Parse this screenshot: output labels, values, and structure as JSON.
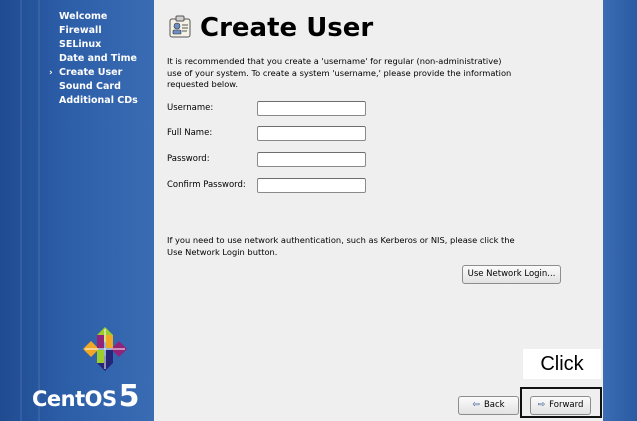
{
  "sidebar": {
    "steps": [
      {
        "label": "Welcome",
        "current": false
      },
      {
        "label": "Firewall",
        "current": false
      },
      {
        "label": "SELinux",
        "current": false
      },
      {
        "label": "Date and Time",
        "current": false
      },
      {
        "label": "Create User",
        "current": true
      },
      {
        "label": "Sound Card",
        "current": false
      },
      {
        "label": "Additional CDs",
        "current": false
      }
    ],
    "current_marker": "›",
    "logo": {
      "text": "CentOS",
      "number": "5"
    }
  },
  "page": {
    "title": "Create User",
    "intro": "It is recommended that you create a 'username' for regular (non-administrative) use of your system. To create a system 'username,' please provide the information requested below.",
    "network_text": "If you need to use network authentication, such as Kerberos or NIS, please click the Use Network Login button."
  },
  "form": {
    "username": {
      "label": "Username:",
      "value": ""
    },
    "full_name": {
      "label": "Full Name:",
      "value": ""
    },
    "password": {
      "label": "Password:",
      "value": ""
    },
    "confirm_password": {
      "label": "Confirm Password:",
      "value": ""
    }
  },
  "buttons": {
    "network_login": "Use Network Login...",
    "back": "Back",
    "forward": "Forward"
  },
  "annotation": {
    "label": "Click"
  },
  "colors": {
    "rail": "#2f5fa8",
    "panel": "#efefef"
  }
}
